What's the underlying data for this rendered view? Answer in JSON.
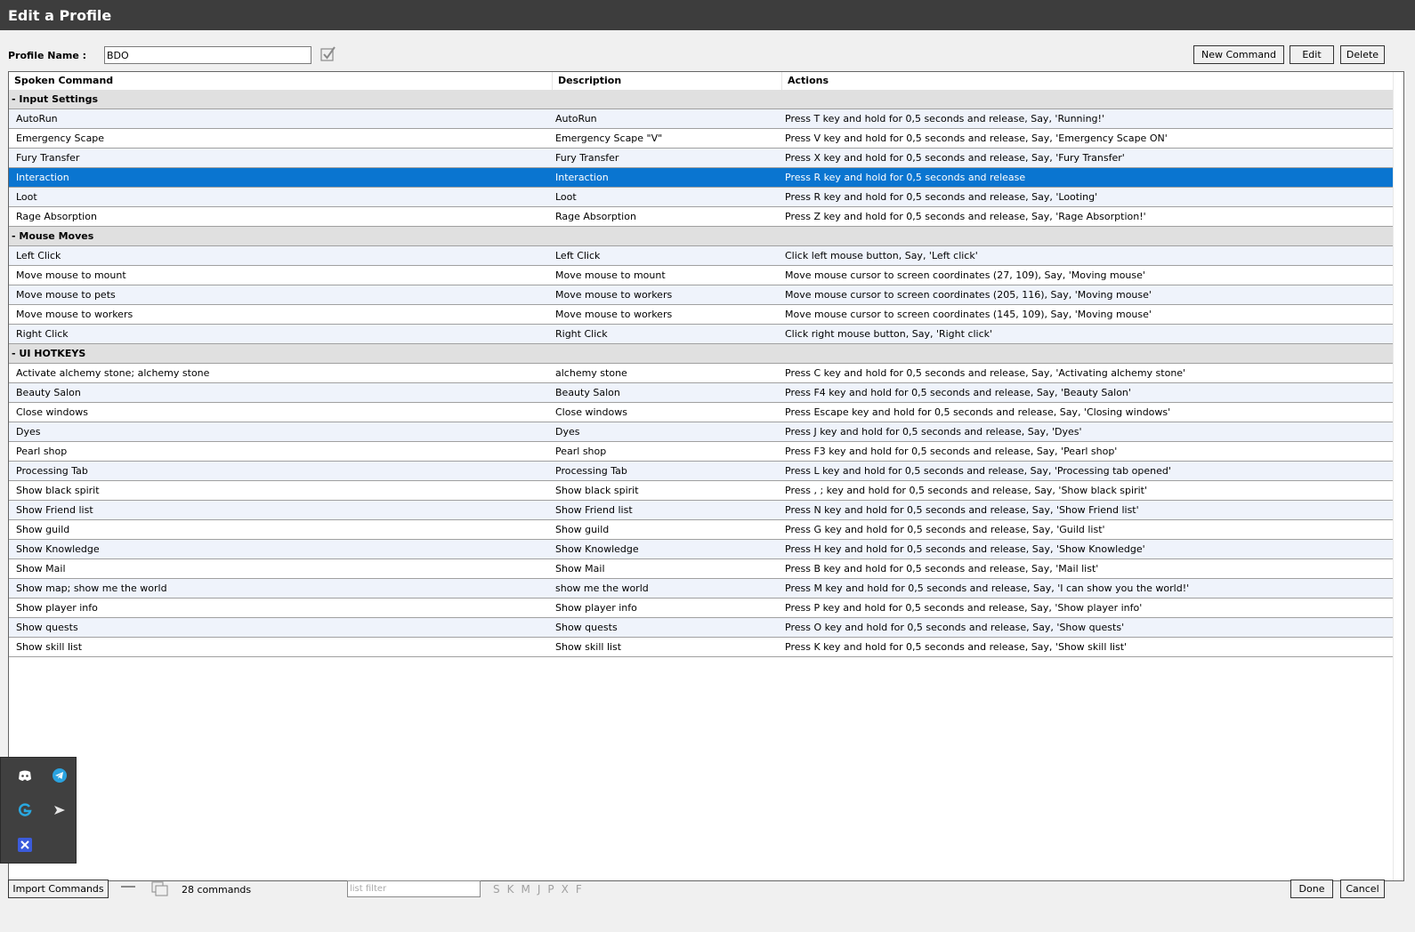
{
  "window": {
    "title": "Edit a Profile"
  },
  "profile": {
    "label": "Profile Name :",
    "value": "BDO"
  },
  "toolbar": {
    "new_command": "New Command",
    "edit": "Edit",
    "delete": "Delete"
  },
  "columns": {
    "spoken": "Spoken Command",
    "description": "Description",
    "actions": "Actions"
  },
  "rows": [
    {
      "group": "- Input Settings"
    },
    {
      "spoken": "AutoRun",
      "description": "AutoRun",
      "action": "Press T key and hold for 0,5 seconds and release, Say, 'Running!'"
    },
    {
      "spoken": "Emergency Scape",
      "description": "Emergency Scape \"V\"",
      "action": "Press V key and hold for 0,5 seconds and release, Say, 'Emergency Scape ON'"
    },
    {
      "spoken": "Fury Transfer",
      "description": "Fury Transfer",
      "action": "Press X key and hold for 0,5 seconds and release, Say, 'Fury Transfer'"
    },
    {
      "spoken": "Interaction",
      "description": "Interaction",
      "action": "Press R key and hold for 0,5 seconds and release",
      "selected": true
    },
    {
      "spoken": "Loot",
      "description": "Loot",
      "action": "Press R key and hold for 0,5 seconds and release, Say, 'Looting'"
    },
    {
      "spoken": "Rage Absorption",
      "description": "Rage Absorption",
      "action": "Press Z key and hold for 0,5 seconds and release, Say, 'Rage Absorption!'"
    },
    {
      "group": "- Mouse Moves"
    },
    {
      "spoken": "Left Click",
      "description": "Left Click",
      "action": "Click left mouse button, Say, 'Left click'"
    },
    {
      "spoken": "Move mouse to mount",
      "description": "Move mouse to mount",
      "action": "Move mouse cursor to screen coordinates (27, 109), Say, 'Moving mouse'"
    },
    {
      "spoken": "Move mouse to pets",
      "description": "Move mouse to workers",
      "action": "Move mouse cursor to screen coordinates (205, 116), Say, 'Moving mouse'"
    },
    {
      "spoken": "Move mouse to workers",
      "description": "Move mouse to workers",
      "action": "Move mouse cursor to screen coordinates (145, 109), Say, 'Moving mouse'"
    },
    {
      "spoken": "Right Click",
      "description": "Right Click",
      "action": "Click right mouse button, Say, 'Right click'"
    },
    {
      "group": "- UI HOTKEYS"
    },
    {
      "spoken": "Activate alchemy stone; alchemy stone",
      "description": "alchemy stone",
      "action": "Press C key and hold for 0,5 seconds and release, Say, 'Activating alchemy stone'"
    },
    {
      "spoken": "Beauty Salon",
      "description": "Beauty Salon",
      "action": "Press F4 key and hold for 0,5 seconds and release, Say, 'Beauty Salon'"
    },
    {
      "spoken": "Close windows",
      "description": "Close windows",
      "action": "Press Escape key and hold for 0,5 seconds and release, Say, 'Closing windows'"
    },
    {
      "spoken": "Dyes",
      "description": "Dyes",
      "action": "Press J key and hold for 0,5 seconds and release, Say, 'Dyes'"
    },
    {
      "spoken": "Pearl shop",
      "description": "Pearl shop",
      "action": "Press F3 key and hold for 0,5 seconds and release, Say, 'Pearl shop'"
    },
    {
      "spoken": "Processing Tab",
      "description": "Processing Tab",
      "action": "Press L key and hold for 0,5 seconds and release, Say, 'Processing tab opened'"
    },
    {
      "spoken": "Show black spirit",
      "description": "Show black spirit",
      "action": "Press , ; key and hold for 0,5 seconds and release, Say, 'Show black spirit'"
    },
    {
      "spoken": "Show Friend list",
      "description": "Show Friend list",
      "action": "Press N key and hold for 0,5 seconds and release, Say, 'Show Friend list'"
    },
    {
      "spoken": "Show guild",
      "description": "Show guild",
      "action": "Press G key and hold for 0,5 seconds and release, Say, 'Guild list'"
    },
    {
      "spoken": "Show Knowledge",
      "description": "Show Knowledge",
      "action": "Press H key and hold for 0,5 seconds and release, Say, 'Show Knowledge'"
    },
    {
      "spoken": "Show Mail",
      "description": "Show Mail",
      "action": "Press B key and hold for 0,5 seconds and release, Say, 'Mail list'"
    },
    {
      "spoken": "Show map; show me the world",
      "description": "show me the world",
      "action": "Press M key and hold for 0,5 seconds and release, Say, 'I can show you the world!'"
    },
    {
      "spoken": "Show player info",
      "description": "Show player info",
      "action": "Press P key and hold for 0,5 seconds and release, Say, 'Show player info'"
    },
    {
      "spoken": "Show quests",
      "description": "Show quests",
      "action": "Press O key and hold for 0,5 seconds and release, Say, 'Show quests'"
    },
    {
      "spoken": "Show skill list",
      "description": "Show skill list",
      "action": "Press K key and hold for 0,5 seconds and release, Say, 'Show skill list'"
    }
  ],
  "tray": {
    "icons": [
      "discord-icon",
      "telegram-icon",
      "logitech-g-icon",
      "airplane-icon",
      "app-x-icon"
    ]
  },
  "footer": {
    "import_label": "Import Commands",
    "count_text": "28 commands",
    "filter_placeholder": "list filter",
    "letters": [
      "S",
      "K",
      "M",
      "J",
      "P",
      "X",
      "F"
    ],
    "done_label": "Done",
    "cancel_label": "Cancel"
  },
  "colors": {
    "titlebar": "#3d3d3d",
    "selection": "#0a75d0",
    "group_row": "#e0e0e0",
    "alt_row": "#eff3fb"
  }
}
